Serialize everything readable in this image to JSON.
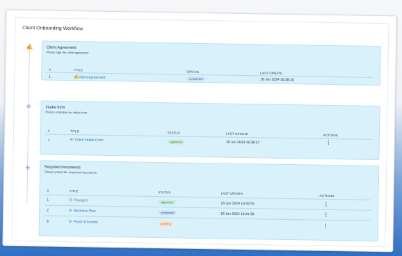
{
  "header": {
    "title": "Client Onboarding Workflow"
  },
  "columns": {
    "num": "#",
    "title": "TITLE",
    "status": "STATUS",
    "last_update": "LAST UPDATE",
    "actions": "ACTIONS"
  },
  "sections": [
    {
      "name": "Client Agreement",
      "subtitle": "Please sign the client agreement",
      "icon": "signature-icon",
      "rows": [
        {
          "num": "1",
          "title": "Client Agreement",
          "status": "completed",
          "last_update": "18 Jun 2024 16:38:10"
        }
      ]
    },
    {
      "name": "Intake form",
      "subtitle": "Please complete our intake form",
      "icon": "form-icon",
      "rows": [
        {
          "num": "1",
          "title": "Client Intake Form",
          "status": "approved",
          "last_update": "18 Jun 2024 16:39:17"
        }
      ]
    },
    {
      "name": "Required documents",
      "subtitle": "Please upload the requested documents",
      "icon": "document-icon",
      "rows": [
        {
          "num": "1",
          "title": "Passport",
          "status": "approved",
          "last_update": "18 Jun 2024 16:42:05"
        },
        {
          "num": "2",
          "title": "Business Plan",
          "status": "completed",
          "last_update": "18 Jun 2024 16:41:36"
        },
        {
          "num": "3",
          "title": "Proof of income",
          "status": "pending",
          "last_update": "-"
        }
      ]
    }
  ],
  "actions_icon": "more-vertical-icon",
  "colors": {
    "section_bg": "#d9f1fb",
    "completed": "#cfe3f7",
    "approved": "#c9ecd6",
    "pending": "#fde2c7",
    "link": "#1f6fae"
  }
}
